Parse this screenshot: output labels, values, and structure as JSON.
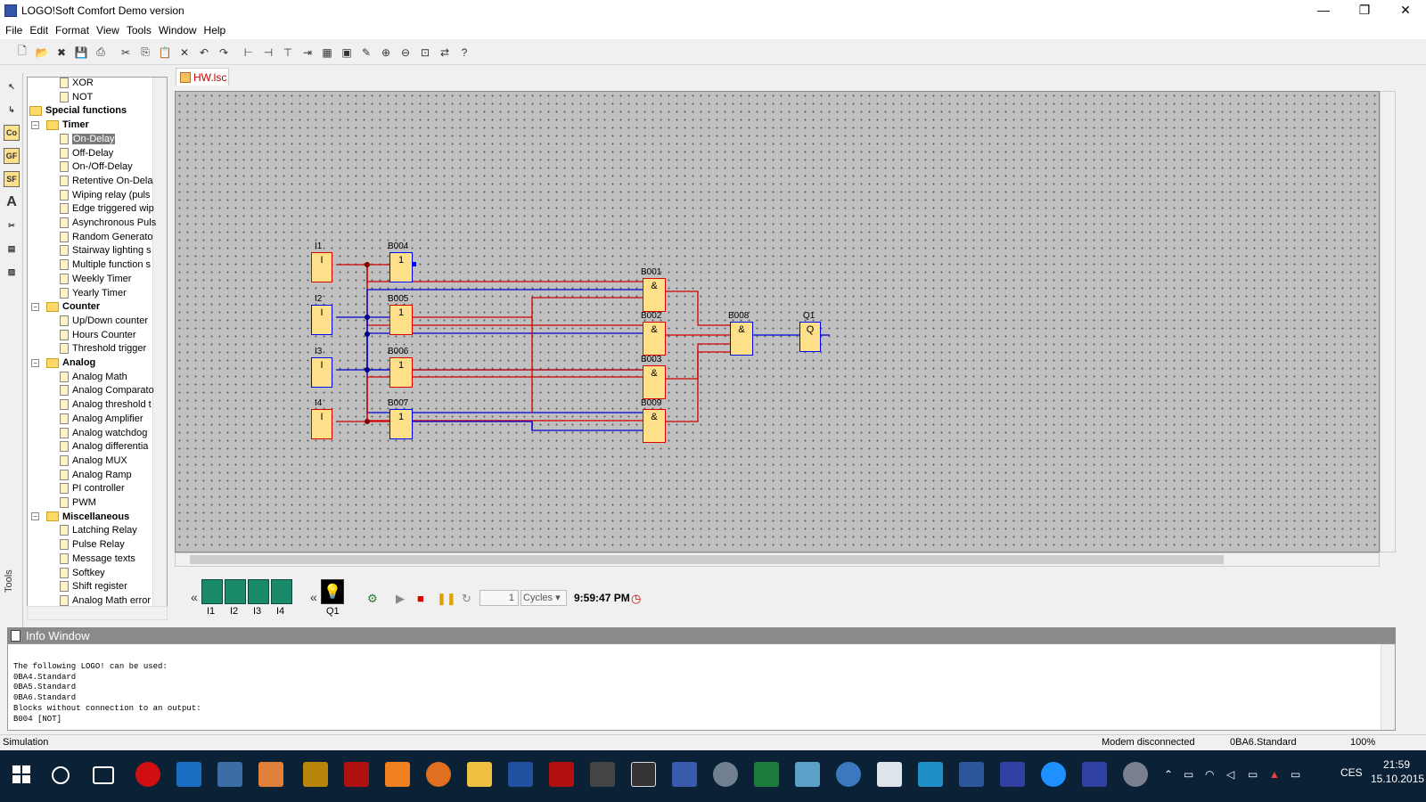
{
  "window": {
    "title": "LOGO!Soft Comfort Demo version",
    "controls": [
      "—",
      "❐",
      "✕"
    ]
  },
  "menu": [
    "File",
    "Edit",
    "Format",
    "View",
    "Tools",
    "Window",
    "Help"
  ],
  "tools_panel_label": "Tools",
  "tree": [
    {
      "label": "XOR",
      "level": 2,
      "type": "leaf"
    },
    {
      "label": "NOT",
      "level": 2,
      "type": "leaf"
    },
    {
      "label": "Special functions",
      "level": 0,
      "type": "folder"
    },
    {
      "label": "Timer",
      "level": 1,
      "type": "folder"
    },
    {
      "label": "On-Delay",
      "level": 2,
      "type": "leaf",
      "selected": true
    },
    {
      "label": "Off-Delay",
      "level": 2,
      "type": "leaf"
    },
    {
      "label": "On-/Off-Delay",
      "level": 2,
      "type": "leaf"
    },
    {
      "label": "Retentive On-Dela",
      "level": 2,
      "type": "leaf"
    },
    {
      "label": "Wiping relay (puls",
      "level": 2,
      "type": "leaf"
    },
    {
      "label": "Edge triggered wip",
      "level": 2,
      "type": "leaf"
    },
    {
      "label": "Asynchronous Puls",
      "level": 2,
      "type": "leaf"
    },
    {
      "label": "Random Generato",
      "level": 2,
      "type": "leaf"
    },
    {
      "label": "Stairway lighting s",
      "level": 2,
      "type": "leaf"
    },
    {
      "label": "Multiple function s",
      "level": 2,
      "type": "leaf"
    },
    {
      "label": "Weekly Timer",
      "level": 2,
      "type": "leaf"
    },
    {
      "label": "Yearly Timer",
      "level": 2,
      "type": "leaf"
    },
    {
      "label": "Counter",
      "level": 1,
      "type": "folder"
    },
    {
      "label": "Up/Down counter",
      "level": 2,
      "type": "leaf"
    },
    {
      "label": "Hours Counter",
      "level": 2,
      "type": "leaf"
    },
    {
      "label": "Threshold trigger",
      "level": 2,
      "type": "leaf"
    },
    {
      "label": "Analog",
      "level": 1,
      "type": "folder"
    },
    {
      "label": "Analog Math",
      "level": 2,
      "type": "leaf"
    },
    {
      "label": "Analog Comparato",
      "level": 2,
      "type": "leaf"
    },
    {
      "label": "Analog threshold t",
      "level": 2,
      "type": "leaf"
    },
    {
      "label": "Analog Amplifier",
      "level": 2,
      "type": "leaf"
    },
    {
      "label": "Analog watchdog",
      "level": 2,
      "type": "leaf"
    },
    {
      "label": "Analog differentia",
      "level": 2,
      "type": "leaf"
    },
    {
      "label": "Analog MUX",
      "level": 2,
      "type": "leaf"
    },
    {
      "label": "Analog Ramp",
      "level": 2,
      "type": "leaf"
    },
    {
      "label": "PI controller",
      "level": 2,
      "type": "leaf"
    },
    {
      "label": "PWM",
      "level": 2,
      "type": "leaf"
    },
    {
      "label": "Miscellaneous",
      "level": 1,
      "type": "folder"
    },
    {
      "label": "Latching Relay",
      "level": 2,
      "type": "leaf"
    },
    {
      "label": "Pulse Relay",
      "level": 2,
      "type": "leaf"
    },
    {
      "label": "Message texts",
      "level": 2,
      "type": "leaf"
    },
    {
      "label": "Softkey",
      "level": 2,
      "type": "leaf"
    },
    {
      "label": "Shift register",
      "level": 2,
      "type": "leaf"
    },
    {
      "label": "Analog Math error",
      "level": 2,
      "type": "leaf"
    }
  ],
  "doc_tab": "HW.lsc",
  "diagram": {
    "blocks": [
      {
        "id": "I1",
        "symbol": "I",
        "color": "red"
      },
      {
        "id": "I2",
        "symbol": "I",
        "color": "blue"
      },
      {
        "id": "I3",
        "symbol": "I",
        "color": "blue"
      },
      {
        "id": "I4",
        "symbol": "I",
        "color": "red"
      },
      {
        "id": "B004",
        "symbol": "1",
        "color": "blue"
      },
      {
        "id": "B005",
        "symbol": "1",
        "color": "red"
      },
      {
        "id": "B006",
        "symbol": "1",
        "color": "red"
      },
      {
        "id": "B007",
        "symbol": "1",
        "color": "blue"
      },
      {
        "id": "B001",
        "symbol": "&",
        "color": "red"
      },
      {
        "id": "B002",
        "symbol": "&",
        "color": "red"
      },
      {
        "id": "B003",
        "symbol": "&",
        "color": "red"
      },
      {
        "id": "B009",
        "symbol": "&",
        "color": "red"
      },
      {
        "id": "B008",
        "symbol": "&",
        "color": "blue"
      },
      {
        "id": "Q1",
        "symbol": "Q",
        "color": "blue"
      }
    ]
  },
  "simulation": {
    "inputs": [
      "I1",
      "I2",
      "I3",
      "I4"
    ],
    "output": "Q1",
    "cycles_value": "1",
    "cycles_unit": "Cycles",
    "time": "9:59:47 PM"
  },
  "info": {
    "title": "Info Window",
    "lines": [
      "The following LOGO! can be used:",
      "0BA4.Standard",
      "0BA5.Standard",
      "0BA6.Standard",
      "Blocks without connection to an output:",
      "B004 [NOT]"
    ]
  },
  "status": {
    "mode": "Simulation",
    "modem": "Modem disconnected",
    "device": "0BA6.Standard",
    "zoom": "100%"
  },
  "taskbar": {
    "lang": "CES",
    "time": "21:59",
    "date": "15.10.2015"
  }
}
